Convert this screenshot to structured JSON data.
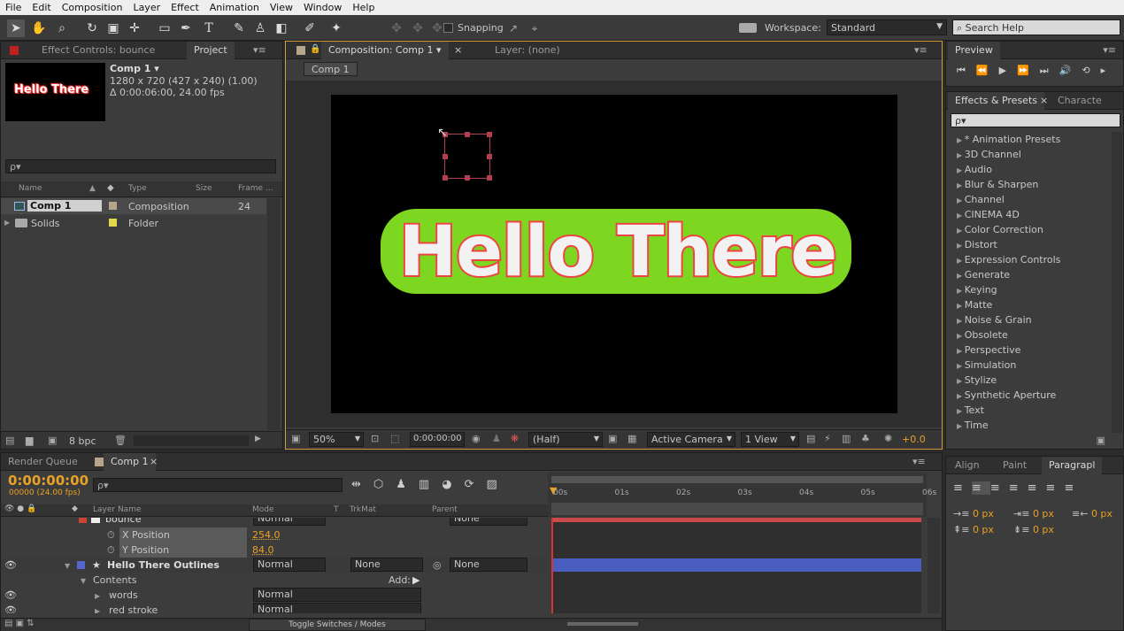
{
  "menu": [
    "File",
    "Edit",
    "Composition",
    "Layer",
    "Effect",
    "Animation",
    "View",
    "Window",
    "Help"
  ],
  "toolbar": {
    "snapping": "Snapping",
    "workspace_label": "Workspace:",
    "workspace_value": "Standard",
    "search_help": "Search Help"
  },
  "left_panel": {
    "tab_effect_controls": "Effect Controls: bounce",
    "tab_project": "Project",
    "comp_name": "Comp 1 ▾",
    "comp_info1": "1280 x 720  (427 x 240) (1.00)",
    "comp_info2": "Δ 0:00:06:00, 24.00 fps",
    "thumb_text": "Hello There",
    "search_placeholder": "ρ▾",
    "columns": {
      "name": "Name",
      "type": "Type",
      "size": "Size",
      "frame": "Frame ..."
    },
    "items": [
      {
        "name": "Comp 1",
        "type": "Composition",
        "frame": "24",
        "color": "#b4a58b"
      },
      {
        "name": "Solids",
        "type": "Folder",
        "frame": "",
        "color": "#e3d84b"
      }
    ],
    "bpc": "8 bpc"
  },
  "comp_panel": {
    "tab_comp": "Composition: Comp 1",
    "tab_layer": "Layer: (none)",
    "breadcrumb": "Comp 1",
    "canvas_text": "Hello There",
    "zoom": "50%",
    "timecode": "0:00:00:00",
    "resolution": "(Half)",
    "camera": "Active Camera",
    "view": "1 View",
    "exposure": "+0.0"
  },
  "preview": {
    "title": "Preview"
  },
  "effects": {
    "tab_effects": "Effects & Presets",
    "tab_character": "Characte",
    "search": "ρ▾",
    "items": [
      "* Animation Presets",
      "3D Channel",
      "Audio",
      "Blur & Sharpen",
      "Channel",
      "CINEMA 4D",
      "Color Correction",
      "Distort",
      "Expression Controls",
      "Generate",
      "Keying",
      "Matte",
      "Noise & Grain",
      "Obsolete",
      "Perspective",
      "Simulation",
      "Stylize",
      "Synthetic Aperture",
      "Text",
      "Time"
    ]
  },
  "paragraph": {
    "tab_align": "Align",
    "tab_paint": "Paint",
    "tab_paragraph": "Paragrapl",
    "indent_values": [
      "0 px",
      "0 px",
      "0 px",
      "0 px",
      "0 px"
    ]
  },
  "timeline": {
    "tab_render": "Render Queue",
    "tab_comp": "Comp 1",
    "timecode": "0:00:00:00",
    "fps": "00000 (24.00 fps)",
    "search": "ρ▾",
    "headers": {
      "layer_name": "Layer Name",
      "mode": "Mode",
      "t": "T",
      "trkmat": "TrkMat",
      "parent": "Parent"
    },
    "ruler": [
      "00s",
      "01s",
      "02s",
      "03s",
      "04s",
      "05s",
      "06s"
    ],
    "rows": [
      {
        "indent": 0,
        "label": "bounce",
        "mode": "Normal",
        "parent": "None",
        "kind": "layer_partial"
      },
      {
        "indent": 1,
        "label": "X Position",
        "value": "254.0",
        "kind": "prop"
      },
      {
        "indent": 1,
        "label": "Y Position",
        "value": "84.0",
        "kind": "prop"
      },
      {
        "indent": 0,
        "label": "Hello There Outlines",
        "mode": "Normal",
        "trkmat": "None",
        "parent": "None",
        "kind": "layer"
      },
      {
        "indent": 1,
        "label": "Contents",
        "add": "Add:",
        "kind": "group"
      },
      {
        "indent": 2,
        "label": "words",
        "mode": "Normal",
        "kind": "sub"
      },
      {
        "indent": 2,
        "label": "red stroke",
        "mode": "Normal",
        "kind": "sub"
      }
    ],
    "toggle": "Toggle Switches / Modes"
  }
}
